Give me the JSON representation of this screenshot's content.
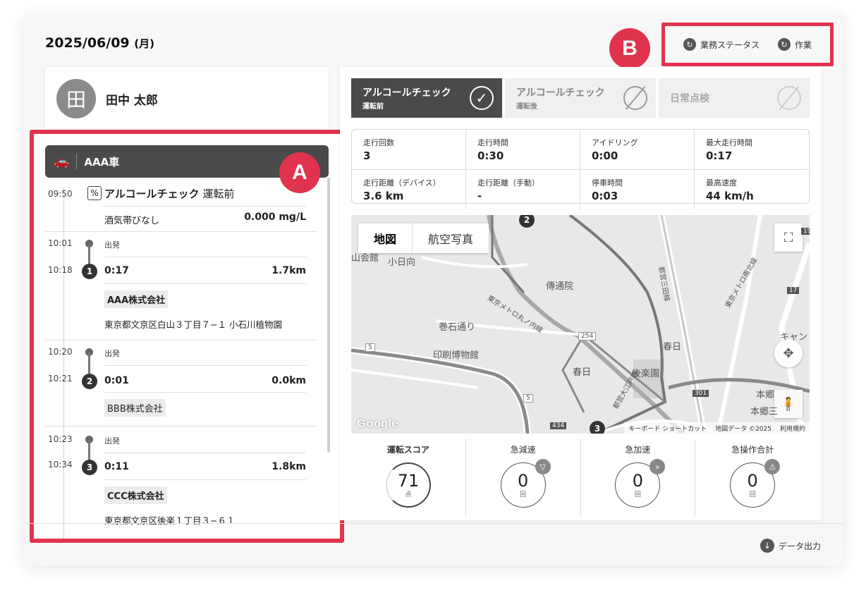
{
  "header": {
    "date": "2025/06/09",
    "weekday": "(月)"
  },
  "actions": [
    {
      "label": "業務ステータス",
      "icon": "refresh-icon"
    },
    {
      "label": "作業",
      "icon": "refresh-icon"
    }
  ],
  "annotations": {
    "a": "A",
    "b": "B"
  },
  "user": {
    "avatar_char": "田",
    "name": "田中 太郎"
  },
  "vehicle": {
    "name": "AAA車",
    "icon": "car-icon"
  },
  "timeline": {
    "alcohol": {
      "time": "09:50",
      "title": "アルコールチェック",
      "subtitle": "運転前",
      "note": "酒気帯びなし",
      "value": "0.000 mg/L"
    },
    "stops": [
      {
        "depart_time": "10:01",
        "depart_label": "出発",
        "arrive_time": "10:18",
        "num": "1",
        "duration": "0:17",
        "distance": "1.7km",
        "company": "AAA株式会社",
        "address": "東京都文京区白山３丁目７−１ 小石川植物園"
      },
      {
        "depart_time": "10:20",
        "depart_label": "出発",
        "arrive_time": "10:21",
        "num": "2",
        "duration": "0:01",
        "distance": "0.0km",
        "company": "BBB株式会社"
      },
      {
        "depart_time": "10:23",
        "depart_label": "出発",
        "arrive_time": "10:34",
        "num": "3",
        "duration": "0:11",
        "distance": "1.8km",
        "company": "CCC株式会社",
        "address": "東京都文京区後楽１丁目３−６１"
      }
    ]
  },
  "tabs": [
    {
      "title": "アルコールチェック",
      "sub": "運転前",
      "state": "checked"
    },
    {
      "title": "アルコールチェック",
      "sub": "運転後",
      "state": "none"
    },
    {
      "title": "日常点検",
      "sub": "",
      "state": "none"
    }
  ],
  "stats": [
    {
      "label": "走行回数",
      "value": "3"
    },
    {
      "label": "走行時間",
      "value": "0:30"
    },
    {
      "label": "アイドリング",
      "value": "0:00"
    },
    {
      "label": "最大走行時間",
      "value": "0:17"
    },
    {
      "label": "走行距離（デバイス）",
      "value": "3.6 km"
    },
    {
      "label": "走行距離（手動）",
      "value": "-"
    },
    {
      "label": "停車時間",
      "value": "0:03"
    },
    {
      "label": "最高速度",
      "value": "44 km/h"
    }
  ],
  "map": {
    "type_buttons": [
      "地図",
      "航空写真"
    ],
    "labels": [
      "小日向",
      "傳通院",
      "巻石通り",
      "印刷博物館",
      "春日",
      "後楽園",
      "春日",
      "本郷",
      "本郷三",
      "キャン",
      "山会館",
      "東京メトロ丸ノ内線",
      "都営三田線",
      "東京メトロ南北線",
      "都営大江戸線"
    ],
    "route_numbers": [
      "2",
      "3"
    ],
    "road_numbers": [
      "5",
      "254",
      "5",
      "434",
      "301",
      "17",
      "19"
    ],
    "google": "Google",
    "footer": [
      "キーボード ショートカット",
      "地図データ ©2025",
      "利用規約"
    ]
  },
  "scores": [
    {
      "label": "運転スコア",
      "value": "71",
      "unit": "点"
    },
    {
      "label": "急減速",
      "value": "0",
      "unit": "回",
      "icon": "triangle-down-icon"
    },
    {
      "label": "急加速",
      "value": "0",
      "unit": "回",
      "icon": "double-chevron-up-icon"
    },
    {
      "label": "急操作合計",
      "value": "0",
      "unit": "回",
      "icon": "warning-icon"
    }
  ],
  "export": {
    "label": "データ出力"
  }
}
